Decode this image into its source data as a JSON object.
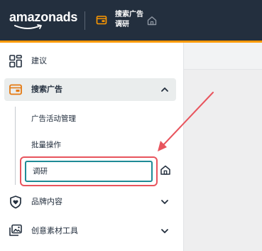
{
  "header": {
    "logo_text": "amazonads",
    "context_title": "搜索广告",
    "context_subtitle": "调研",
    "icons": {
      "context": "ad-card-icon",
      "home": "home-icon"
    },
    "colors": {
      "bar": "#232f3e",
      "accent": "#ff9900",
      "context_icon": "#ff9900"
    }
  },
  "sidebar": {
    "items": [
      {
        "label": "建议",
        "icon": "grid-icon"
      },
      {
        "label": "搜索广告",
        "icon": "ad-card-icon",
        "expanded": true,
        "chevron": "chevron-up-icon"
      },
      {
        "label": "品牌内容",
        "icon": "shield-heart-icon",
        "chevron": "chevron-down-icon"
      },
      {
        "label": "创意素材工具",
        "icon": "image-stack-icon",
        "chevron": "chevron-down-icon"
      }
    ],
    "sub_items": [
      {
        "label": "广告活动管理"
      },
      {
        "label": "批量操作"
      },
      {
        "label": "调研",
        "selected": true,
        "shortcut_icon": "home-icon"
      }
    ],
    "colors": {
      "active_group_bg": "#eaeded",
      "selected_border": "#1f8b96",
      "highlight_box": "#e8545d",
      "icon_orange": "#e47911"
    }
  },
  "annotation": {
    "arrow_color": "#e8545d"
  }
}
